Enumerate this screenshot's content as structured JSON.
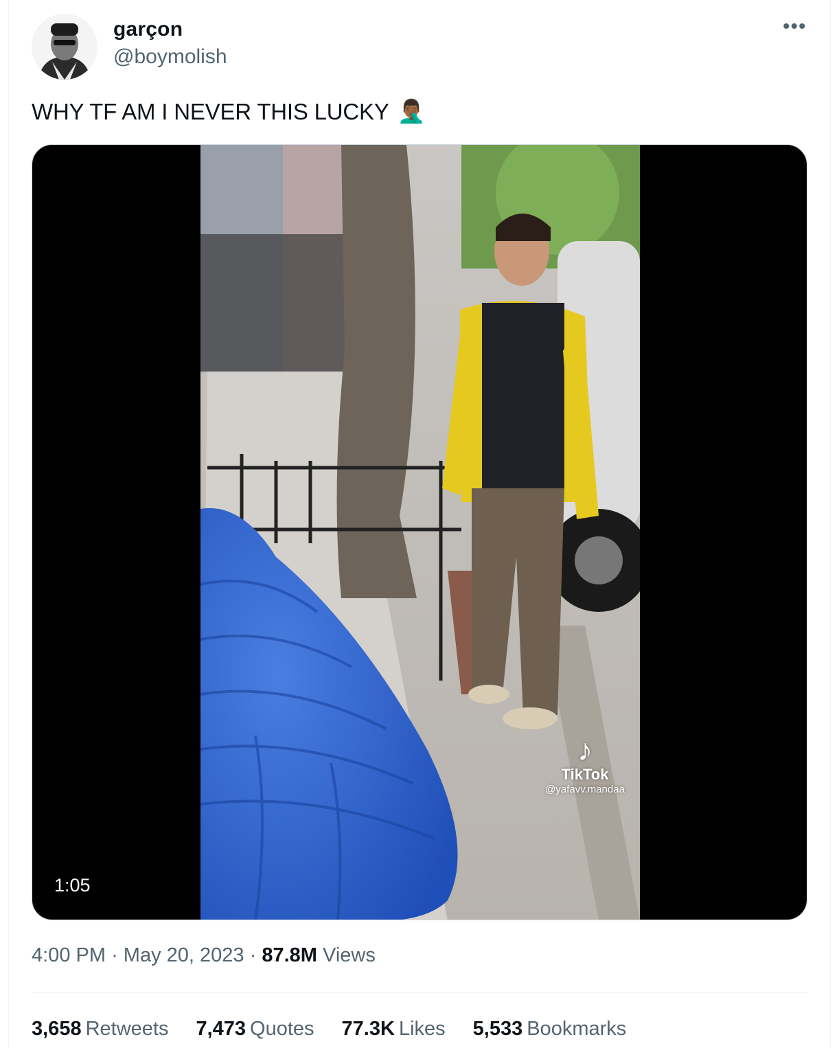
{
  "author": {
    "display_name": "garçon",
    "handle": "@boymolish"
  },
  "tweet": {
    "text": "WHY TF AM I NEVER THIS LUCKY",
    "emoji": "🤦🏾‍♂️"
  },
  "media": {
    "duration": "1:05",
    "watermark_brand": "TikTok",
    "watermark_user": "@yafavv.mandaa"
  },
  "meta": {
    "time": "4:00 PM",
    "separator": "·",
    "date": "May 20, 2023",
    "views_count": "87.8M",
    "views_label": "Views"
  },
  "stats": [
    {
      "count": "3,658",
      "label": "Retweets"
    },
    {
      "count": "7,473",
      "label": "Quotes"
    },
    {
      "count": "77.3K",
      "label": "Likes"
    },
    {
      "count": "5,533",
      "label": "Bookmarks"
    }
  ],
  "icons": {
    "more": "ellipsis-icon",
    "avatar": "user-avatar"
  }
}
